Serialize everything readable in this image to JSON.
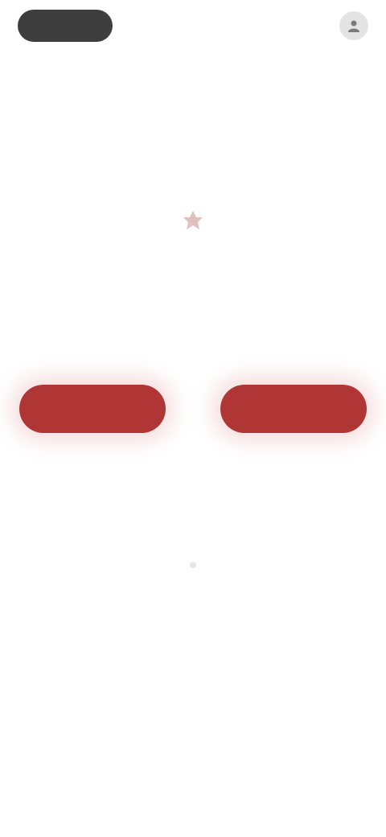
{
  "header": {
    "logo": "",
    "link": "",
    "icon": "user-icon"
  },
  "subheader": "",
  "emblem": {
    "icon": "flag-icon",
    "caption": ""
  },
  "title": {
    "line1": "",
    "line2": ""
  },
  "buttons": [
    {
      "label": ""
    },
    {
      "label": ""
    }
  ],
  "body_text": "",
  "footer_link": "",
  "colors": {
    "accent": "#b03535",
    "logo_bg": "#3d3d3d",
    "muted_text": "#a8a8a8"
  }
}
